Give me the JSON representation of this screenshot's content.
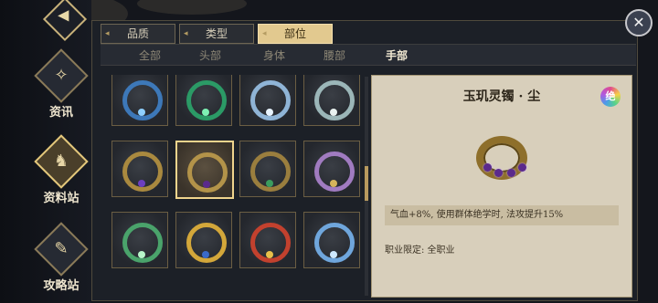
{
  "nav": {
    "back_icon": "back-arrow-icon",
    "items": [
      {
        "label": "资讯",
        "icon": "scroll-icon",
        "glyph": "✧",
        "active": false
      },
      {
        "label": "资料站",
        "icon": "tiger-emblem-icon",
        "glyph": "♞",
        "active": true
      },
      {
        "label": "攻略站",
        "icon": "feather-quill-icon",
        "glyph": "✎",
        "active": false
      }
    ]
  },
  "filter_tabs": [
    {
      "label": "品质",
      "active": false
    },
    {
      "label": "类型",
      "active": false
    },
    {
      "label": "部位",
      "active": true
    }
  ],
  "sub_tabs": [
    {
      "label": "全部",
      "active": false
    },
    {
      "label": "头部",
      "active": false
    },
    {
      "label": "身体",
      "active": false
    },
    {
      "label": "腰部",
      "active": false
    },
    {
      "label": "手部",
      "active": true
    }
  ],
  "items": [
    {
      "icon": "blue-serpent-bracelet-icon",
      "color": "#3d78b8",
      "gem": "#8fd0ff"
    },
    {
      "icon": "jade-serpent-bracelet-icon",
      "color": "#2b9a66",
      "gem": "#7ef2b4"
    },
    {
      "icon": "silver-winged-bracelet-icon",
      "color": "#8fb4d6",
      "gem": "#e8f4ff"
    },
    {
      "icon": "pale-winged-bracelet-icon",
      "color": "#9bb6b8",
      "gem": "#e9f2f0"
    },
    {
      "icon": "gold-jeweled-bracelet-icon",
      "color": "#a9893f",
      "gem": "#6c3fbf"
    },
    {
      "icon": "gold-purple-gem-bracelet-icon",
      "color": "#b39349",
      "gem": "#5b2a8c",
      "selected": true
    },
    {
      "icon": "gold-green-gem-bracelet-icon",
      "color": "#9a7e3e",
      "gem": "#3b9c5e"
    },
    {
      "icon": "violet-gold-bracelet-icon",
      "color": "#a07bc0",
      "gem": "#d6b45a"
    },
    {
      "icon": "jade-dragon-bracelet-icon",
      "color": "#4aa36b",
      "gem": "#b7f5c9"
    },
    {
      "icon": "gold-dragon-bracelet-icon",
      "color": "#d3a73a",
      "gem": "#3a6ac8"
    },
    {
      "icon": "crimson-dragon-bracelet-icon",
      "color": "#c2412e",
      "gem": "#e8c04a"
    },
    {
      "icon": "ice-jade-bangle-icon",
      "color": "#6fa6dc",
      "gem": "#cfe9ff"
    }
  ],
  "detail": {
    "name": "玉玑灵镯 · 尘",
    "badge": "绝",
    "badge_icon": "rainbow-rank-badge-icon",
    "image_icon": "gold-purple-gem-bracelet-icon",
    "description": "气血+8%, 使用群体绝学时, 法攻提升15%",
    "requirement": "职业限定: 全职业"
  },
  "close_icon": "close-x-icon",
  "close_glyph": "✕"
}
